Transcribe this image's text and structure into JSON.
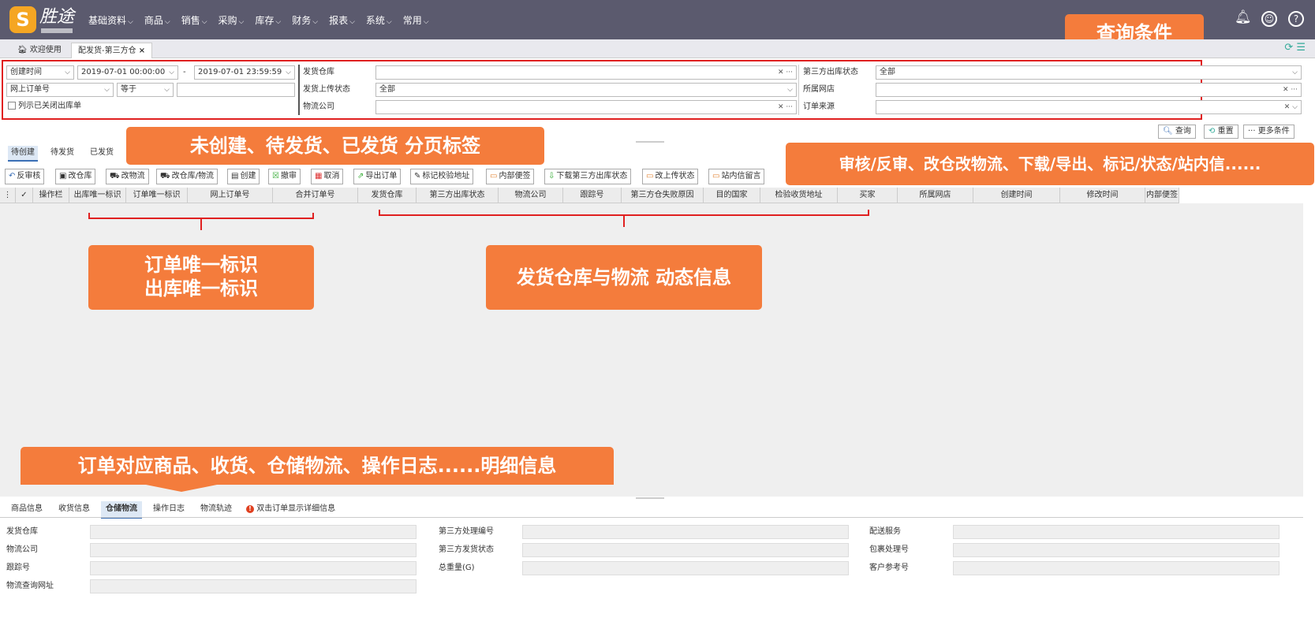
{
  "app": {
    "logo_letter": "S",
    "logo_text": "胜途"
  },
  "nav": [
    "基础资料",
    "商品",
    "销售",
    "采购",
    "库存",
    "财务",
    "报表",
    "系统",
    "常用"
  ],
  "top_icons": [
    "bell-icon",
    "user-circle-icon",
    "help-icon"
  ],
  "tabs": [
    {
      "label": "欢迎使用"
    },
    {
      "label": "配发货-第三方仓"
    }
  ],
  "tab_close": "×",
  "query": {
    "time_field": "创建时间",
    "start_time": "2019-07-01 00:00:00",
    "end_time": "2019-07-01 23:59:59",
    "dash": "-",
    "order_no_field": "网上订单号",
    "equal_op": "等于",
    "show_closed": "列示已关闭出库单",
    "warehouse_label": "发货仓库",
    "upload_status_label": "发货上传状态",
    "upload_status_value": "全部",
    "logistics_label": "物流公司",
    "third_status_label": "第三方出库状态",
    "third_status_value": "全部",
    "shop_label": "所属网店",
    "source_label": "订单来源",
    "more_dots": "···"
  },
  "callouts": {
    "query_conditions": "查询条件",
    "page_tabs": "未创建、待发货、已发货 分页标签",
    "actions": "审核/反审、改仓改物流、下载/导出、标记/状态/站内信......",
    "unique_ids_line1": "订单唯一标识",
    "unique_ids_line2": "出库唯一标识",
    "dynamic_info": "发货仓库与物流 动态信息",
    "detail_info": "订单对应商品、收货、仓储物流、操作日志......明细信息"
  },
  "page_tabs": [
    "待创建",
    "待发货",
    "已发货"
  ],
  "query_buttons": [
    "查询",
    "重置",
    "更多条件"
  ],
  "toolbar": [
    "反审核",
    "改仓库",
    "改物流",
    "改仓库/物流",
    "创建",
    "撤审",
    "取消",
    "导出订单",
    "标记校验地址",
    "内部便签",
    "下载第三方出库状态",
    "改上传状态",
    "站内信留言"
  ],
  "grid_columns": [
    "操作栏",
    "出库唯一标识",
    "订单唯一标识",
    "网上订单号",
    "合并订单号",
    "发货仓库",
    "第三方出库状态",
    "物流公司",
    "跟踪号",
    "第三方仓失败原因",
    "目的国家",
    "检验收货地址",
    "买家",
    "所属网店",
    "创建时间",
    "修改时间",
    "内部便签"
  ],
  "detail_tabs": [
    "商品信息",
    "收货信息",
    "仓储物流",
    "操作日志",
    "物流轨迹"
  ],
  "detail_hint": "双击订单显示详细信息",
  "detail_fields": {
    "col1": [
      "发货仓库",
      "物流公司",
      "跟踪号",
      "物流查询网址"
    ],
    "col2": [
      "第三方处理编号",
      "第三方发货状态",
      "总重量(G)"
    ],
    "col3": [
      "配送服务",
      "包裹处理号",
      "客户参考号"
    ]
  }
}
